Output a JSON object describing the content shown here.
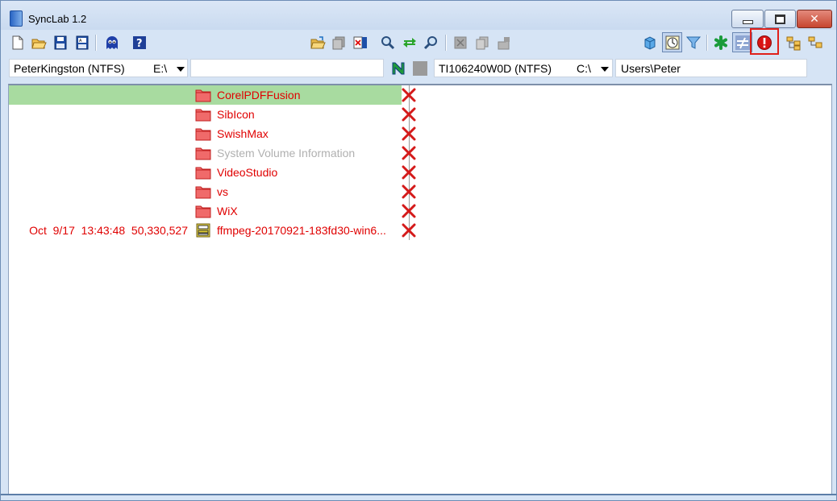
{
  "window": {
    "title": "SyncLab 1.2",
    "controls": {
      "minimize": "minimize-icon",
      "maximize": "maximize-icon",
      "close": "close-icon",
      "close_glyph": "✕"
    }
  },
  "toolbar": {
    "left_icons": [
      "new-file-icon",
      "open-folder-icon",
      "save-icon",
      "save-as-icon",
      "ghost-icon",
      "help-icon"
    ],
    "middle_icons": [
      "folder-open-icon",
      "copy-files-icon",
      "delete-file-icon",
      "find-icon",
      "sync-arrows-icon",
      "find-next-icon",
      "delete-disabled-icon",
      "copy-disabled-icon",
      "move-disabled-icon"
    ],
    "right_icons": [
      "cube-icon",
      "clock-icon",
      "filter-icon",
      "asterisk-icon",
      "not-equal-icon",
      "error-icon",
      "tree-expand-icon",
      "tree-collapse-icon"
    ]
  },
  "left_pane": {
    "volume": "PeterKingston (NTFS)",
    "drive": "E:\\",
    "path": ""
  },
  "right_pane": {
    "volume": "TI106240W0D (NTFS)",
    "drive": "C:\\",
    "path": "Users\\Peter"
  },
  "rows": [
    {
      "meta": "",
      "name": "CorelPDFFusion",
      "type": "folder",
      "selected": true,
      "muted": false
    },
    {
      "meta": "",
      "name": "SibIcon",
      "type": "folder",
      "selected": false,
      "muted": false
    },
    {
      "meta": "",
      "name": "SwishMax",
      "type": "folder",
      "selected": false,
      "muted": false
    },
    {
      "meta": "",
      "name": "System Volume Information",
      "type": "folder",
      "selected": false,
      "muted": true
    },
    {
      "meta": "",
      "name": "VideoStudio",
      "type": "folder",
      "selected": false,
      "muted": false
    },
    {
      "meta": "",
      "name": "vs",
      "type": "folder",
      "selected": false,
      "muted": false
    },
    {
      "meta": "",
      "name": "WiX",
      "type": "folder",
      "selected": false,
      "muted": false
    },
    {
      "meta": "Oct  9/17  13:43:48  50,330,527",
      "name": "ffmpeg-20170921-183fd30-win6...",
      "type": "archive",
      "selected": false,
      "muted": false
    }
  ],
  "colors": {
    "missing_text": "#e00000",
    "muted_text": "#b0b0b0",
    "selection": "#a8dba0",
    "highlight_box": "#e0201a"
  }
}
